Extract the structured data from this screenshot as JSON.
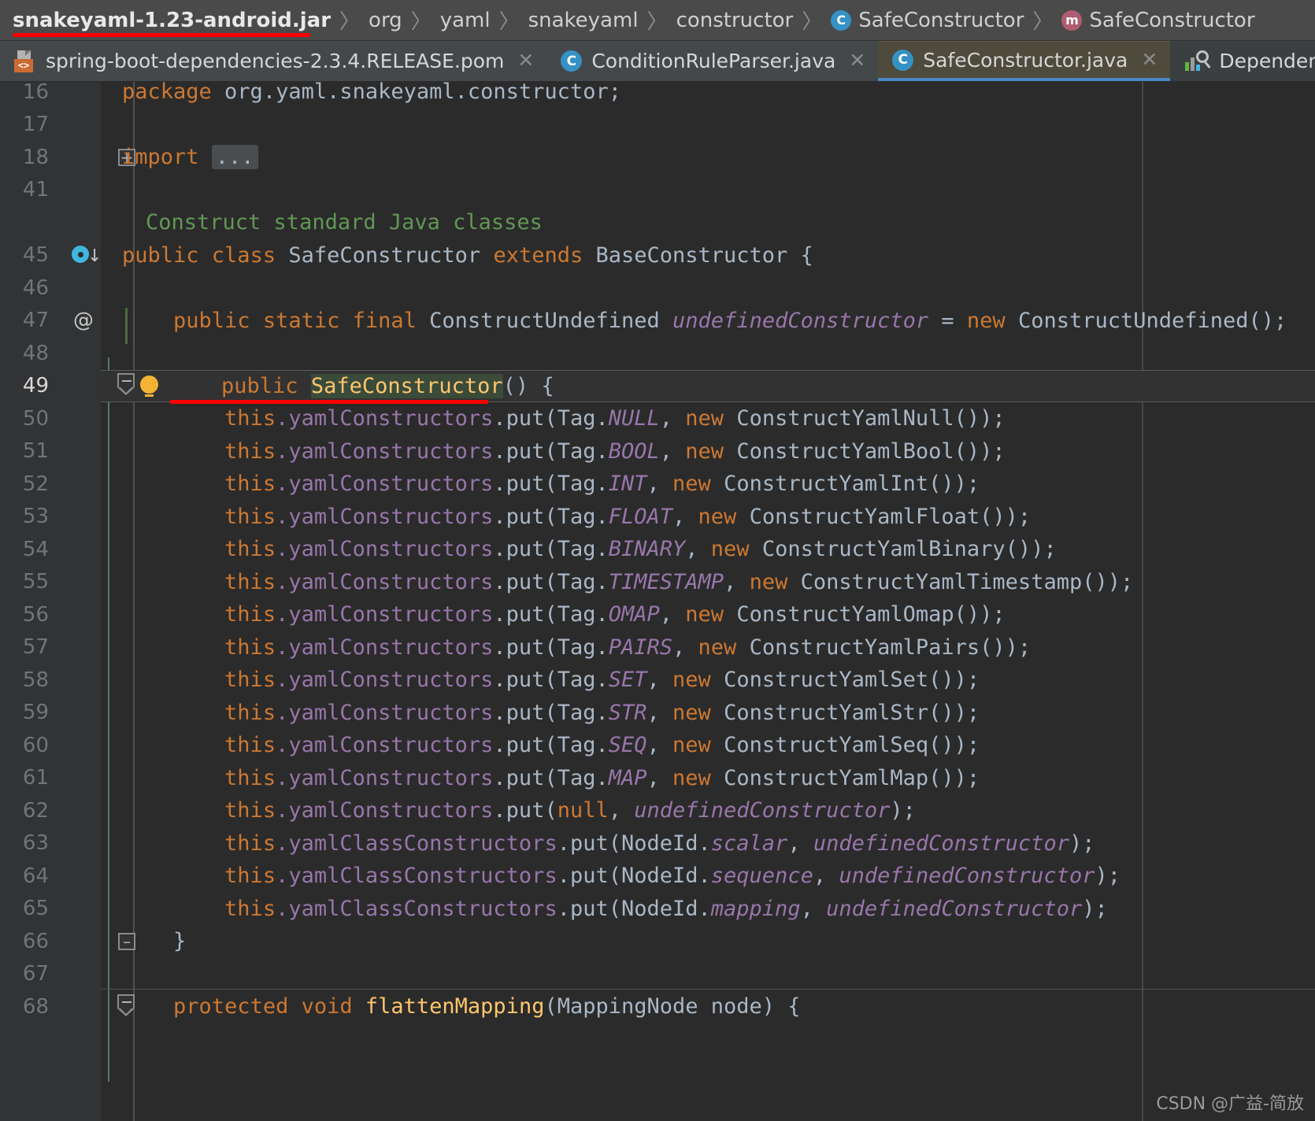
{
  "breadcrumb": {
    "items": [
      {
        "label": "snakeyaml-1.23-android.jar",
        "icon": "",
        "bold": true
      },
      {
        "label": "org",
        "icon": ""
      },
      {
        "label": "yaml",
        "icon": ""
      },
      {
        "label": "snakeyaml",
        "icon": ""
      },
      {
        "label": "constructor",
        "icon": ""
      },
      {
        "label": "SafeConstructor",
        "icon": "class-icon",
        "icon_letter": "C"
      },
      {
        "label": "SafeConstructor",
        "icon": "method-icon",
        "icon_letter": "m"
      }
    ],
    "separator": "〉",
    "highlight_color": "#ff0000"
  },
  "tabs": [
    {
      "label": "spring-boot-dependencies-2.3.4.RELEASE.pom",
      "icon": "maven-pom-icon",
      "active": false,
      "close": "✕"
    },
    {
      "label": "ConditionRuleParser.java",
      "icon": "java-class-icon",
      "icon_letter": "C",
      "active": false,
      "close": "✕"
    },
    {
      "label": "SafeConstructor.java",
      "icon": "java-class-icon",
      "icon_letter": "C",
      "active": true,
      "close": "✕"
    },
    {
      "label": "Dependency Analyzer",
      "icon": "dependency-analyzer-icon",
      "active": false,
      "close": "✕"
    }
  ],
  "editor": {
    "xml_badge": "<>",
    "folded_placeholder": "...",
    "doc_comment": "Construct standard Java classes",
    "lines": [
      {
        "no": "16",
        "indent": 0,
        "tokens": [
          {
            "t": "package ",
            "c": "kw"
          },
          {
            "t": "org.yaml.snakeyaml.constructor;",
            "c": "pl"
          }
        ]
      },
      {
        "no": "17",
        "indent": 0,
        "tokens": []
      },
      {
        "no": "18",
        "indent": 0,
        "fold": "plus",
        "tokens": [
          {
            "t": "import ",
            "c": "kw"
          },
          {
            "t": "...",
            "c": "chip"
          }
        ]
      },
      {
        "no": "41",
        "indent": 0,
        "tokens": []
      },
      {
        "no": "",
        "indent": 1,
        "tokens": [
          {
            "t": "Construct standard Java classes",
            "c": "cmt"
          }
        ]
      },
      {
        "no": "45",
        "indent": 0,
        "gutter": "implemented-marker",
        "tokens": [
          {
            "t": "public ",
            "c": "kw"
          },
          {
            "t": "class ",
            "c": "kw"
          },
          {
            "t": "SafeConstructor ",
            "c": "pl"
          },
          {
            "t": "extends ",
            "c": "kw"
          },
          {
            "t": "BaseConstructor {",
            "c": "pl"
          }
        ]
      },
      {
        "no": "46",
        "indent": 0,
        "tokens": []
      },
      {
        "no": "47",
        "indent": 0,
        "gutter": "override-marker",
        "tokens": [
          {
            "t": "    ",
            "c": "pl"
          },
          {
            "t": "public ",
            "c": "kw"
          },
          {
            "t": "static ",
            "c": "kw"
          },
          {
            "t": "final ",
            "c": "kw"
          },
          {
            "t": "ConstructUndefined ",
            "c": "pl"
          },
          {
            "t": "undefinedConstructor",
            "c": "fldi"
          },
          {
            "t": " = ",
            "c": "pl"
          },
          {
            "t": "new ",
            "c": "kw"
          },
          {
            "t": "ConstructUndefined();",
            "c": "pl"
          }
        ]
      },
      {
        "no": "48",
        "indent": 0,
        "tokens": []
      },
      {
        "no": "49",
        "indent": 0,
        "current": true,
        "gutter": "fold-collapse",
        "bulb": true,
        "tokens": [
          {
            "t": "    ",
            "c": "pl"
          },
          {
            "t": "public ",
            "c": "kw"
          },
          {
            "t": "SafeConstructor",
            "c": "sel"
          },
          {
            "t": "() {",
            "c": "pl"
          }
        ]
      },
      {
        "no": "50",
        "indent": 0,
        "tokens": [
          {
            "t": "        ",
            "c": "pl"
          },
          {
            "t": "this",
            "c": "kw"
          },
          {
            "t": ".yamlConstructors",
            "c": "fld"
          },
          {
            "t": ".put(Tag.",
            "c": "pl"
          },
          {
            "t": "NULL",
            "c": "fldi"
          },
          {
            "t": ", ",
            "c": "pl"
          },
          {
            "t": "new ",
            "c": "kw"
          },
          {
            "t": "ConstructYamlNull());",
            "c": "pl"
          }
        ]
      },
      {
        "no": "51",
        "indent": 0,
        "tokens": [
          {
            "t": "        ",
            "c": "pl"
          },
          {
            "t": "this",
            "c": "kw"
          },
          {
            "t": ".yamlConstructors",
            "c": "fld"
          },
          {
            "t": ".put(Tag.",
            "c": "pl"
          },
          {
            "t": "BOOL",
            "c": "fldi"
          },
          {
            "t": ", ",
            "c": "pl"
          },
          {
            "t": "new ",
            "c": "kw"
          },
          {
            "t": "ConstructYamlBool());",
            "c": "pl"
          }
        ]
      },
      {
        "no": "52",
        "indent": 0,
        "tokens": [
          {
            "t": "        ",
            "c": "pl"
          },
          {
            "t": "this",
            "c": "kw"
          },
          {
            "t": ".yamlConstructors",
            "c": "fld"
          },
          {
            "t": ".put(Tag.",
            "c": "pl"
          },
          {
            "t": "INT",
            "c": "fldi"
          },
          {
            "t": ", ",
            "c": "pl"
          },
          {
            "t": "new ",
            "c": "kw"
          },
          {
            "t": "ConstructYamlInt());",
            "c": "pl"
          }
        ]
      },
      {
        "no": "53",
        "indent": 0,
        "tokens": [
          {
            "t": "        ",
            "c": "pl"
          },
          {
            "t": "this",
            "c": "kw"
          },
          {
            "t": ".yamlConstructors",
            "c": "fld"
          },
          {
            "t": ".put(Tag.",
            "c": "pl"
          },
          {
            "t": "FLOAT",
            "c": "fldi"
          },
          {
            "t": ", ",
            "c": "pl"
          },
          {
            "t": "new ",
            "c": "kw"
          },
          {
            "t": "ConstructYamlFloat());",
            "c": "pl"
          }
        ]
      },
      {
        "no": "54",
        "indent": 0,
        "tokens": [
          {
            "t": "        ",
            "c": "pl"
          },
          {
            "t": "this",
            "c": "kw"
          },
          {
            "t": ".yamlConstructors",
            "c": "fld"
          },
          {
            "t": ".put(Tag.",
            "c": "pl"
          },
          {
            "t": "BINARY",
            "c": "fldi"
          },
          {
            "t": ", ",
            "c": "pl"
          },
          {
            "t": "new ",
            "c": "kw"
          },
          {
            "t": "ConstructYamlBinary());",
            "c": "pl"
          }
        ]
      },
      {
        "no": "55",
        "indent": 0,
        "tokens": [
          {
            "t": "        ",
            "c": "pl"
          },
          {
            "t": "this",
            "c": "kw"
          },
          {
            "t": ".yamlConstructors",
            "c": "fld"
          },
          {
            "t": ".put(Tag.",
            "c": "pl"
          },
          {
            "t": "TIMESTAMP",
            "c": "fldi"
          },
          {
            "t": ", ",
            "c": "pl"
          },
          {
            "t": "new ",
            "c": "kw"
          },
          {
            "t": "ConstructYamlTimestamp());",
            "c": "pl"
          }
        ]
      },
      {
        "no": "56",
        "indent": 0,
        "tokens": [
          {
            "t": "        ",
            "c": "pl"
          },
          {
            "t": "this",
            "c": "kw"
          },
          {
            "t": ".yamlConstructors",
            "c": "fld"
          },
          {
            "t": ".put(Tag.",
            "c": "pl"
          },
          {
            "t": "OMAP",
            "c": "fldi"
          },
          {
            "t": ", ",
            "c": "pl"
          },
          {
            "t": "new ",
            "c": "kw"
          },
          {
            "t": "ConstructYamlOmap());",
            "c": "pl"
          }
        ]
      },
      {
        "no": "57",
        "indent": 0,
        "tokens": [
          {
            "t": "        ",
            "c": "pl"
          },
          {
            "t": "this",
            "c": "kw"
          },
          {
            "t": ".yamlConstructors",
            "c": "fld"
          },
          {
            "t": ".put(Tag.",
            "c": "pl"
          },
          {
            "t": "PAIRS",
            "c": "fldi"
          },
          {
            "t": ", ",
            "c": "pl"
          },
          {
            "t": "new ",
            "c": "kw"
          },
          {
            "t": "ConstructYamlPairs());",
            "c": "pl"
          }
        ]
      },
      {
        "no": "58",
        "indent": 0,
        "tokens": [
          {
            "t": "        ",
            "c": "pl"
          },
          {
            "t": "this",
            "c": "kw"
          },
          {
            "t": ".yamlConstructors",
            "c": "fld"
          },
          {
            "t": ".put(Tag.",
            "c": "pl"
          },
          {
            "t": "SET",
            "c": "fldi"
          },
          {
            "t": ", ",
            "c": "pl"
          },
          {
            "t": "new ",
            "c": "kw"
          },
          {
            "t": "ConstructYamlSet());",
            "c": "pl"
          }
        ]
      },
      {
        "no": "59",
        "indent": 0,
        "tokens": [
          {
            "t": "        ",
            "c": "pl"
          },
          {
            "t": "this",
            "c": "kw"
          },
          {
            "t": ".yamlConstructors",
            "c": "fld"
          },
          {
            "t": ".put(Tag.",
            "c": "pl"
          },
          {
            "t": "STR",
            "c": "fldi"
          },
          {
            "t": ", ",
            "c": "pl"
          },
          {
            "t": "new ",
            "c": "kw"
          },
          {
            "t": "ConstructYamlStr());",
            "c": "pl"
          }
        ]
      },
      {
        "no": "60",
        "indent": 0,
        "tokens": [
          {
            "t": "        ",
            "c": "pl"
          },
          {
            "t": "this",
            "c": "kw"
          },
          {
            "t": ".yamlConstructors",
            "c": "fld"
          },
          {
            "t": ".put(Tag.",
            "c": "pl"
          },
          {
            "t": "SEQ",
            "c": "fldi"
          },
          {
            "t": ", ",
            "c": "pl"
          },
          {
            "t": "new ",
            "c": "kw"
          },
          {
            "t": "ConstructYamlSeq());",
            "c": "pl"
          }
        ]
      },
      {
        "no": "61",
        "indent": 0,
        "tokens": [
          {
            "t": "        ",
            "c": "pl"
          },
          {
            "t": "this",
            "c": "kw"
          },
          {
            "t": ".yamlConstructors",
            "c": "fld"
          },
          {
            "t": ".put(Tag.",
            "c": "pl"
          },
          {
            "t": "MAP",
            "c": "fldi"
          },
          {
            "t": ", ",
            "c": "pl"
          },
          {
            "t": "new ",
            "c": "kw"
          },
          {
            "t": "ConstructYamlMap());",
            "c": "pl"
          }
        ]
      },
      {
        "no": "62",
        "indent": 0,
        "tokens": [
          {
            "t": "        ",
            "c": "pl"
          },
          {
            "t": "this",
            "c": "kw"
          },
          {
            "t": ".yamlConstructors",
            "c": "fld"
          },
          {
            "t": ".put(",
            "c": "pl"
          },
          {
            "t": "null",
            "c": "kw"
          },
          {
            "t": ", ",
            "c": "pl"
          },
          {
            "t": "undefinedConstructor",
            "c": "fldi"
          },
          {
            "t": ");",
            "c": "pl"
          }
        ]
      },
      {
        "no": "63",
        "indent": 0,
        "tokens": [
          {
            "t": "        ",
            "c": "pl"
          },
          {
            "t": "this",
            "c": "kw"
          },
          {
            "t": ".yamlClassConstructors",
            "c": "fld"
          },
          {
            "t": ".put(NodeId.",
            "c": "pl"
          },
          {
            "t": "scalar",
            "c": "fldi"
          },
          {
            "t": ", ",
            "c": "pl"
          },
          {
            "t": "undefinedConstructor",
            "c": "fldi"
          },
          {
            "t": ");",
            "c": "pl"
          }
        ]
      },
      {
        "no": "64",
        "indent": 0,
        "tokens": [
          {
            "t": "        ",
            "c": "pl"
          },
          {
            "t": "this",
            "c": "kw"
          },
          {
            "t": ".yamlClassConstructors",
            "c": "fld"
          },
          {
            "t": ".put(NodeId.",
            "c": "pl"
          },
          {
            "t": "sequence",
            "c": "fldi"
          },
          {
            "t": ", ",
            "c": "pl"
          },
          {
            "t": "undefinedConstructor",
            "c": "fldi"
          },
          {
            "t": ");",
            "c": "pl"
          }
        ]
      },
      {
        "no": "65",
        "indent": 0,
        "tokens": [
          {
            "t": "        ",
            "c": "pl"
          },
          {
            "t": "this",
            "c": "kw"
          },
          {
            "t": ".yamlClassConstructors",
            "c": "fld"
          },
          {
            "t": ".put(NodeId.",
            "c": "pl"
          },
          {
            "t": "mapping",
            "c": "fldi"
          },
          {
            "t": ", ",
            "c": "pl"
          },
          {
            "t": "undefinedConstructor",
            "c": "fldi"
          },
          {
            "t": ");",
            "c": "pl"
          }
        ]
      },
      {
        "no": "66",
        "indent": 0,
        "gutter": "fold-end",
        "tokens": [
          {
            "t": "    }",
            "c": "pl"
          }
        ]
      },
      {
        "no": "67",
        "indent": 0,
        "tokens": []
      },
      {
        "no": "68",
        "indent": 0,
        "gutter": "fold-collapse2",
        "tokens": [
          {
            "t": "    ",
            "c": "pl"
          },
          {
            "t": "protected ",
            "c": "kw"
          },
          {
            "t": "void ",
            "c": "kw"
          },
          {
            "t": "flattenMapping",
            "c": "mdecl"
          },
          {
            "t": "(MappingNode node) {",
            "c": "pl"
          }
        ]
      }
    ]
  },
  "watermark": "CSDN @广益-简放",
  "colors": {
    "editor_bg": "#2b2b2b",
    "gutter_bg": "#313335",
    "keyword": "#cc7832",
    "field": "#9876aa",
    "comment": "#629755",
    "method_decl": "#ffc66d",
    "plain": "#a9b7c6",
    "accent_blue": "#3592c4",
    "underline_red": "#ff0000"
  }
}
